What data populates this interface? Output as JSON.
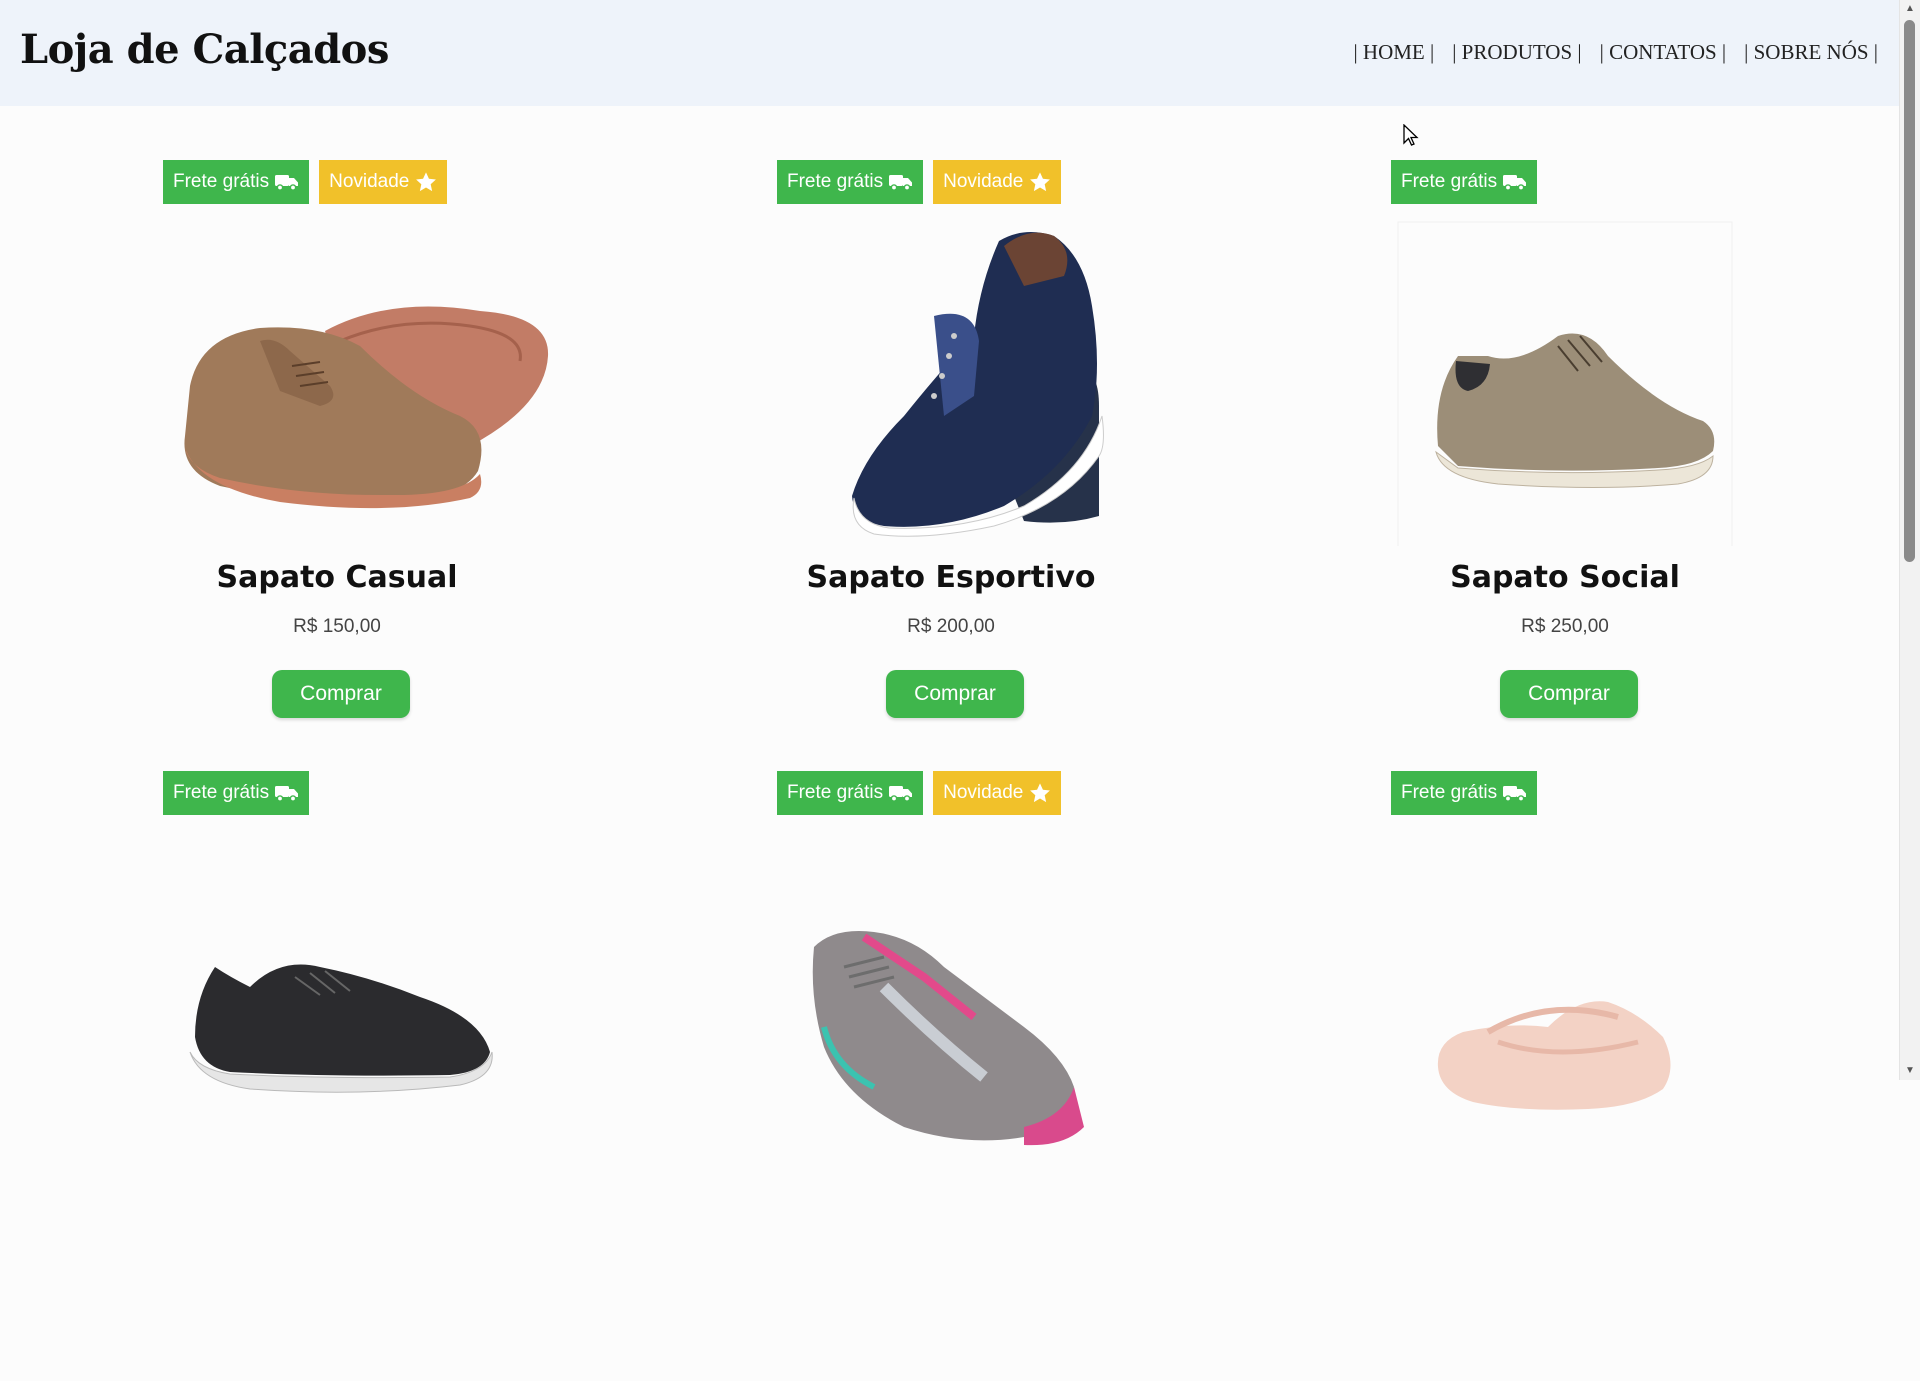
{
  "header": {
    "title": "Loja de Calçados",
    "nav": [
      "| HOME |",
      "| PRODUTOS |",
      "| CONTATOS |",
      "| SOBRE NÓS |"
    ]
  },
  "badges": {
    "free_shipping": "Frete grátis",
    "new": "Novidade"
  },
  "colors": {
    "green": "#3fb64c",
    "yellow": "#f1c12a",
    "header_bg": "#eef3fa"
  },
  "products": [
    {
      "name": "Sapato Casual",
      "price": "R$ 150,00",
      "buy": "Comprar",
      "new": true,
      "image": "brown-casual-shoe"
    },
    {
      "name": "Sapato Esportivo",
      "price": "R$ 200,00",
      "buy": "Comprar",
      "new": true,
      "image": "navy-sneaker-pair"
    },
    {
      "name": "Sapato Social",
      "price": "R$ 250,00",
      "buy": "Comprar",
      "new": false,
      "image": "beige-social-shoe"
    },
    {
      "new": false,
      "image": "black-running-sneaker"
    },
    {
      "new": true,
      "image": "grey-pink-running-shoe"
    },
    {
      "new": false,
      "image": "pink-ballet-slipper"
    }
  ]
}
